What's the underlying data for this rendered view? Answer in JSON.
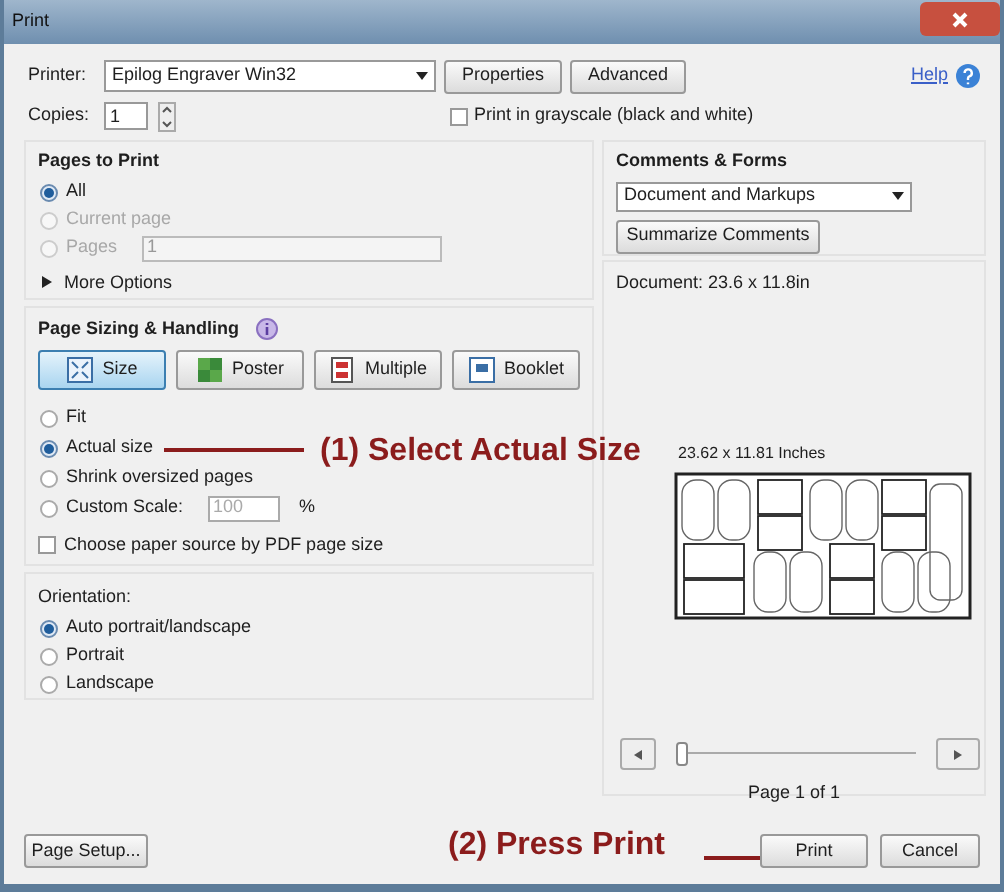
{
  "window": {
    "title": "Print"
  },
  "printer": {
    "label": "Printer:",
    "value": "Epilog Engraver Win32",
    "buttons": [
      "Properties",
      "Advanced"
    ]
  },
  "help": "Help",
  "copies": {
    "label": "Copies:",
    "value": "1"
  },
  "grayscale": {
    "label": "Print in grayscale (black and white)",
    "checked": false
  },
  "pages_to_print": {
    "title": "Pages to Print",
    "options": [
      {
        "label": "All",
        "selected": true,
        "disabled": false,
        "kind": "plain"
      },
      {
        "label": "Current page",
        "selected": false,
        "disabled": true,
        "kind": "plain"
      },
      {
        "label": "Pages",
        "selected": false,
        "disabled": true,
        "kind": "field",
        "value": "1"
      }
    ],
    "more_options": "More Options"
  },
  "page_sizing": {
    "title": "Page Sizing & Handling",
    "tabs": [
      {
        "label": "Size",
        "selected": true,
        "kind": "size"
      },
      {
        "label": "Poster",
        "selected": false,
        "kind": "poster"
      },
      {
        "label": "Multiple",
        "selected": false,
        "kind": "multiple"
      },
      {
        "label": "Booklet",
        "selected": false,
        "kind": "booklet"
      }
    ],
    "options": [
      {
        "label": "Fit",
        "selected": false,
        "kind": "plain"
      },
      {
        "label": "Actual size",
        "selected": true,
        "kind": "plain"
      },
      {
        "label": "Shrink oversized pages",
        "selected": false,
        "kind": "plain"
      },
      {
        "label": "Custom Scale:",
        "selected": false,
        "kind": "field",
        "value": "100",
        "suffix": "%"
      }
    ],
    "paper_source": {
      "label": "Choose paper source by PDF page size",
      "checked": false
    }
  },
  "orientation": {
    "title": "Orientation:",
    "options": [
      {
        "label": "Auto portrait/landscape",
        "selected": true
      },
      {
        "label": "Portrait",
        "selected": false
      },
      {
        "label": "Landscape",
        "selected": false
      }
    ]
  },
  "comments_forms": {
    "title": "Comments & Forms",
    "value": "Document and Markups",
    "button": "Summarize Comments"
  },
  "document_size": "Document: 23.6 x 11.8in",
  "preview": {
    "size": "23.62 x 11.81 Inches",
    "level": 0,
    "page": "Page 1 of 1"
  },
  "buttons": [
    "Page Setup...",
    "Print",
    "Cancel"
  ],
  "annotations": [
    {
      "text": "(1) Select Actual Size"
    },
    {
      "text": "(2) Press Print"
    }
  ]
}
